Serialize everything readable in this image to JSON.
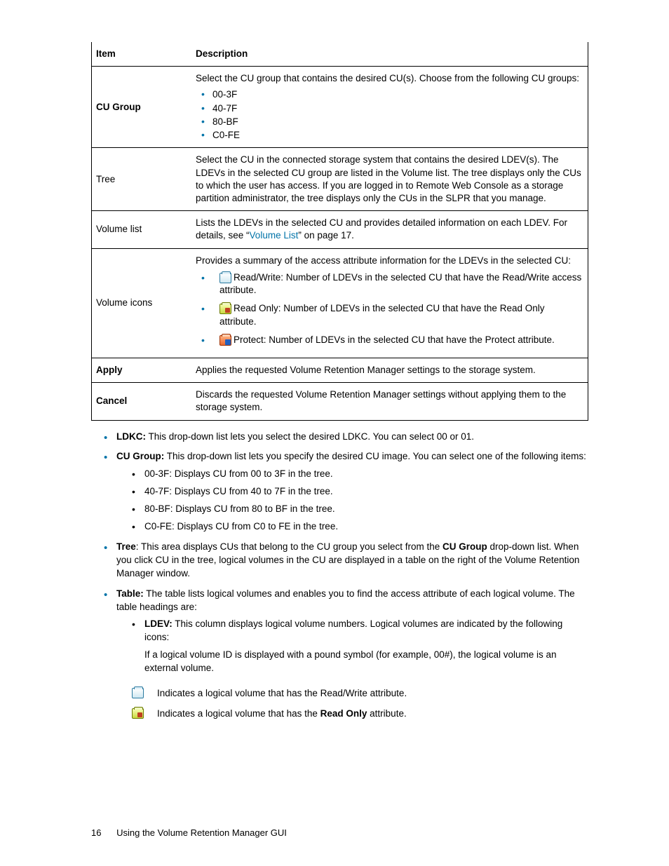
{
  "table": {
    "headers": [
      "Item",
      "Description"
    ],
    "rows": {
      "cu_group": {
        "item": "CU Group",
        "desc_intro": "Select the CU group that contains the desired CU(s). Choose from the following CU groups:",
        "opts": [
          "00-3F",
          "40-7F",
          "80-BF",
          "C0-FE"
        ]
      },
      "tree": {
        "item": "Tree",
        "desc": "Select the CU in the connected storage system that contains the desired LDEV(s). The LDEVs in the selected CU group are listed in the Volume list. The tree displays only the CUs to which the user has access. If you are logged in to Remote Web Console as a storage partition administrator, the tree displays only the CUs in the SLPR that you manage."
      },
      "volume_list": {
        "item": "Volume list",
        "desc_a": "Lists the LDEVs in the selected CU and provides detailed information on each LDEV. For details, see “",
        "desc_link": "Volume List",
        "desc_b": "” on page 17."
      },
      "volume_icons": {
        "item": "Volume icons",
        "desc_intro": "Provides a summary of the access attribute information for the LDEVs in the selected CU:",
        "rw": "Read/Write: Number of LDEVs in the selected CU that have the Read/Write access attribute.",
        "ro": "Read Only: Number of LDEVs in the selected CU that have the Read Only attribute.",
        "pr": "Protect: Number of LDEVs in the selected CU that have the Protect attribute."
      },
      "apply": {
        "item": "Apply",
        "desc": "Applies the requested Volume Retention Manager settings to the storage system."
      },
      "cancel": {
        "item": "Cancel",
        "desc": "Discards the requested Volume Retention Manager settings without applying them to the storage system."
      }
    }
  },
  "outer": {
    "ldkc": {
      "label": "LDKC:",
      "text": " This drop-down list lets you select the desired LDKC. You can select 00 or 01."
    },
    "cu_group": {
      "label": "CU Group:",
      "text": " This drop-down list lets you specify the desired CU image. You can select one of the following items:",
      "items": [
        "00-3F: Displays CU from 00 to 3F in the tree.",
        "40-7F: Displays CU from 40 to 7F in the tree.",
        "80-BF: Displays CU from 80 to BF in the tree.",
        "C0-FE: Displays CU from C0 to FE in the tree."
      ]
    },
    "tree": {
      "label": "Tree",
      "text_a": ": This area displays CUs that belong to the CU group you select from the ",
      "bold": "CU Group",
      "text_b": " drop-down list. When you click CU in the tree, logical volumes in the CU are displayed in a table on the right of the Volume Retention Manager window."
    },
    "tbl": {
      "label": "Table:",
      "text": " The table lists logical volumes and enables you to find the access attribute of each logical volume. The table headings are:",
      "ldev": {
        "label": "LDEV:",
        "text": " This column displays logical volume numbers. Logical volumes are indicated by the following icons:",
        "note": "If a logical volume ID is displayed with a pound symbol (for example, 00#), the logical volume is an external volume."
      }
    }
  },
  "legend": {
    "rw": "Indicates a logical volume that has the Read/Write attribute.",
    "ro_a": "Indicates a logical volume that has the ",
    "ro_bold": "Read Only",
    "ro_b": " attribute."
  },
  "footer": {
    "page": "16",
    "title": "Using the Volume Retention Manager GUI"
  }
}
